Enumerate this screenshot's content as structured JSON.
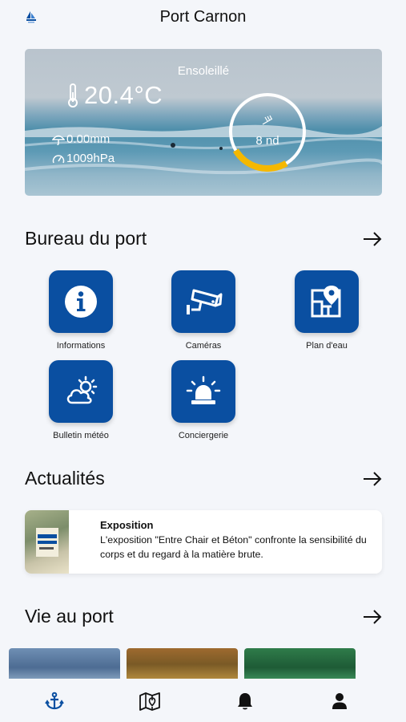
{
  "header": {
    "title": "Port Carnon",
    "logo_icon": "sailboat-logo-icon"
  },
  "weather": {
    "condition": "Ensoleillé",
    "temperature": "20.4°C",
    "rain": "0.00mm",
    "pressure": "1009hPa",
    "wind": "8 nd",
    "wind_gauge_fraction": 0.25,
    "accent_color": "#f5b800"
  },
  "bureau": {
    "title": "Bureau du port",
    "tiles": [
      {
        "label": "Informations",
        "icon": "info-icon"
      },
      {
        "label": "Caméras",
        "icon": "camera-icon"
      },
      {
        "label": "Plan d'eau",
        "icon": "map-pin-icon"
      },
      {
        "label": "Bulletin météo",
        "icon": "cloud-sun-icon"
      },
      {
        "label": "Conciergerie",
        "icon": "siren-icon"
      }
    ]
  },
  "news": {
    "title": "Actualités",
    "items": [
      {
        "title": "Exposition",
        "text": "L'exposition \"Entre Chair et Béton\" confronte la sensibilité du corps et du regard à la matière brute."
      }
    ]
  },
  "vie": {
    "title": "Vie au port"
  },
  "nav": {
    "items": [
      "anchor-icon",
      "map-icon",
      "bell-icon",
      "user-icon"
    ],
    "active_color": "#0a4fa1"
  },
  "colors": {
    "primary": "#0a4fa1",
    "background": "#f4f6fa"
  }
}
